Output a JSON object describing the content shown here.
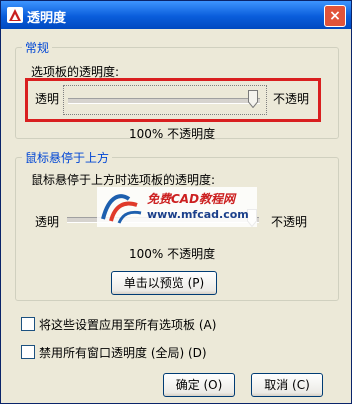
{
  "window": {
    "title": "透明度",
    "close_label": "×"
  },
  "general": {
    "legend": "常规",
    "palette_label": "选项板的透明度:",
    "left_label": "透明",
    "right_label": "不透明",
    "value_text": "100% 不透明度",
    "slider_level": 1.0
  },
  "hover": {
    "legend": "鼠标悬停于上方",
    "label": "鼠标悬停于上方时选项板的透明度:",
    "left_label": "透明",
    "right_label": "不透明",
    "value_text": "100% 不透明度",
    "preview_button": "单击以预览 (P)",
    "slider_level": 1.0
  },
  "options": [
    {
      "label": "将这些设置应用至所有选项板 (A)",
      "checked": false
    },
    {
      "label": "禁用所有窗口透明度 (全局) (D)",
      "checked": false
    }
  ],
  "buttons": {
    "ok": "确定 (O)",
    "cancel": "取消 (C)"
  },
  "watermark": {
    "brand": "免费CAD教程网",
    "url": "www.mfcad.com"
  },
  "colors": {
    "legend": "#0046d5",
    "highlight": "#d91f1f",
    "titlebar": "#0a5ddb"
  }
}
